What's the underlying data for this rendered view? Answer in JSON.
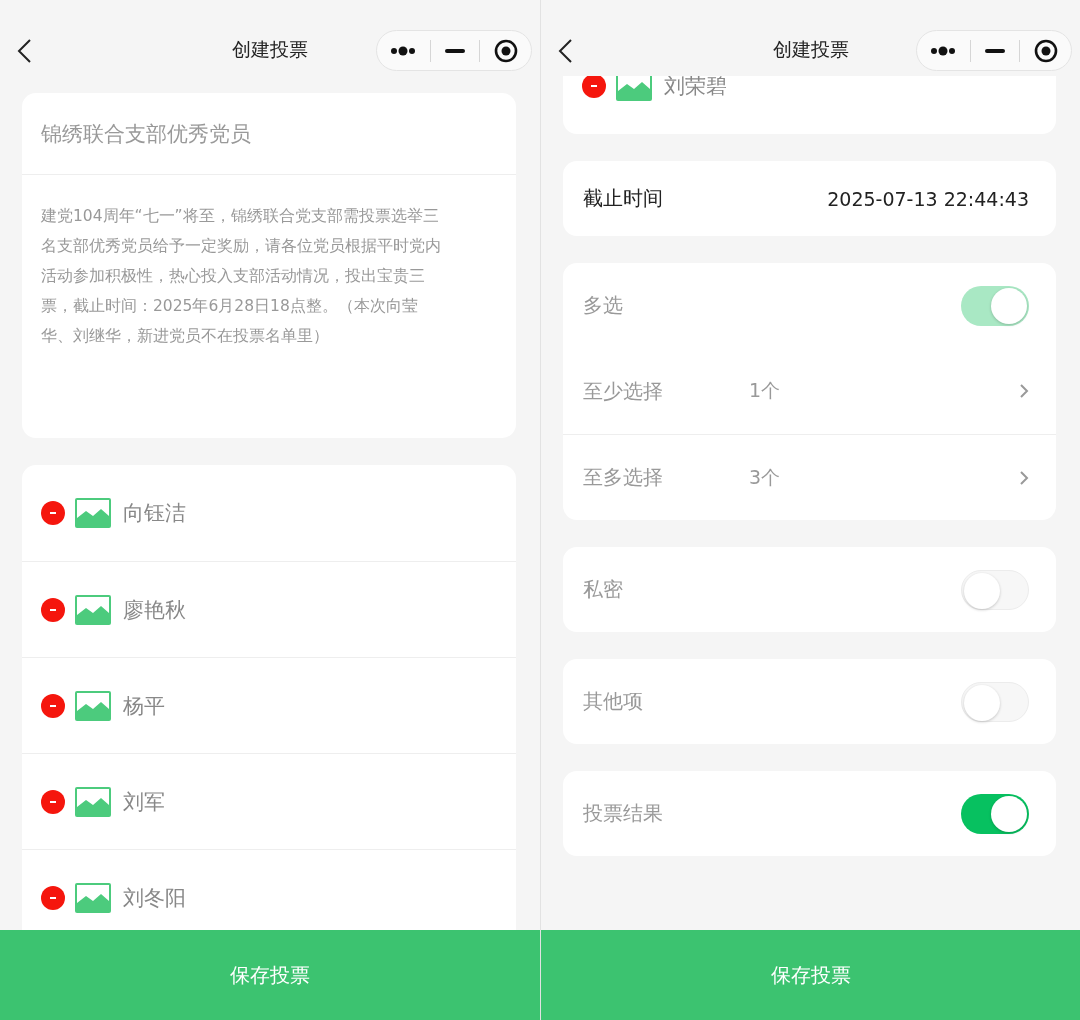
{
  "screens": [
    {
      "nav": {
        "title": "创建投票"
      },
      "vote": {
        "title": "锦绣联合支部优秀党员",
        "description": "建党104周年“七一”将至，锦绣联合党支部需投票选举三名支部优秀党员给予一定奖励，请各位党员根据平时党内活动参加积极性，热心投入支部活动情况，投出宝贵三票，截止时间：2025年6月28日18点整。（本次向莹华、刘继华，新进党员不在投票名单里）"
      },
      "candidates": [
        {
          "name": "向钰洁"
        },
        {
          "name": "廖艳秋"
        },
        {
          "name": "杨平"
        },
        {
          "name": "刘军"
        },
        {
          "name": "刘冬阳"
        }
      ],
      "save_button": "保存投票"
    },
    {
      "nav": {
        "title": "创建投票"
      },
      "candidates": [
        {
          "name": "刘荣碧"
        }
      ],
      "groups": [
        {
          "items": [
            {
              "kind": "time",
              "label": "截止时间",
              "value": "2025-07-13 22:44:43"
            }
          ]
        },
        {
          "items": [
            {
              "kind": "toggle",
              "label": "多选",
              "on": true,
              "disabled": true
            },
            {
              "kind": "select",
              "label": "至少选择",
              "value": "1个"
            },
            {
              "kind": "select",
              "label": "至多选择",
              "value": "3个"
            }
          ]
        },
        {
          "items": [
            {
              "kind": "toggle",
              "label": "私密",
              "on": false,
              "disabled": false
            }
          ]
        },
        {
          "items": [
            {
              "kind": "toggle",
              "label": "其他项",
              "on": false,
              "disabled": false
            }
          ]
        },
        {
          "items": [
            {
              "kind": "toggle",
              "label": "投票结果",
              "on": true,
              "disabled": false
            }
          ]
        }
      ],
      "save_button": "保存投票"
    }
  ]
}
